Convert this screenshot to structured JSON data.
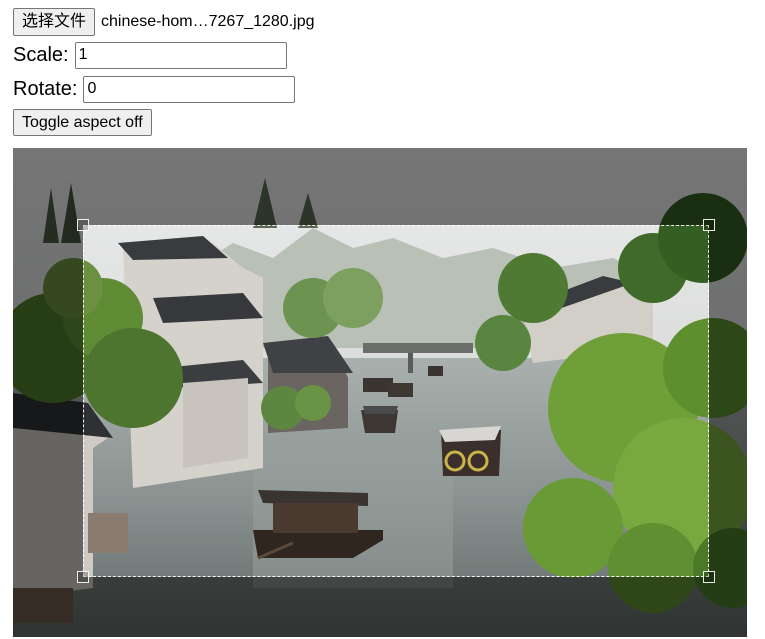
{
  "file_input": {
    "button_label": "选择文件",
    "file_name": "chinese-hom…7267_1280.jpg"
  },
  "scale": {
    "label": "Scale:",
    "value": "1"
  },
  "rotate": {
    "label": "Rotate:",
    "value": "0"
  },
  "toggle_aspect": {
    "label": "Toggle aspect off"
  },
  "crop": {
    "image_subject": "water town canal with boats and traditional houses",
    "selection_border": "dashed",
    "colors": {
      "sky": "#e6e6e8",
      "water": "#8e9694",
      "foliage": "#6c9a3a",
      "house_wall": "#d9d6d0",
      "roof": "#3b3b3d",
      "boat": "#3a2e26",
      "shade": "#000000"
    }
  }
}
